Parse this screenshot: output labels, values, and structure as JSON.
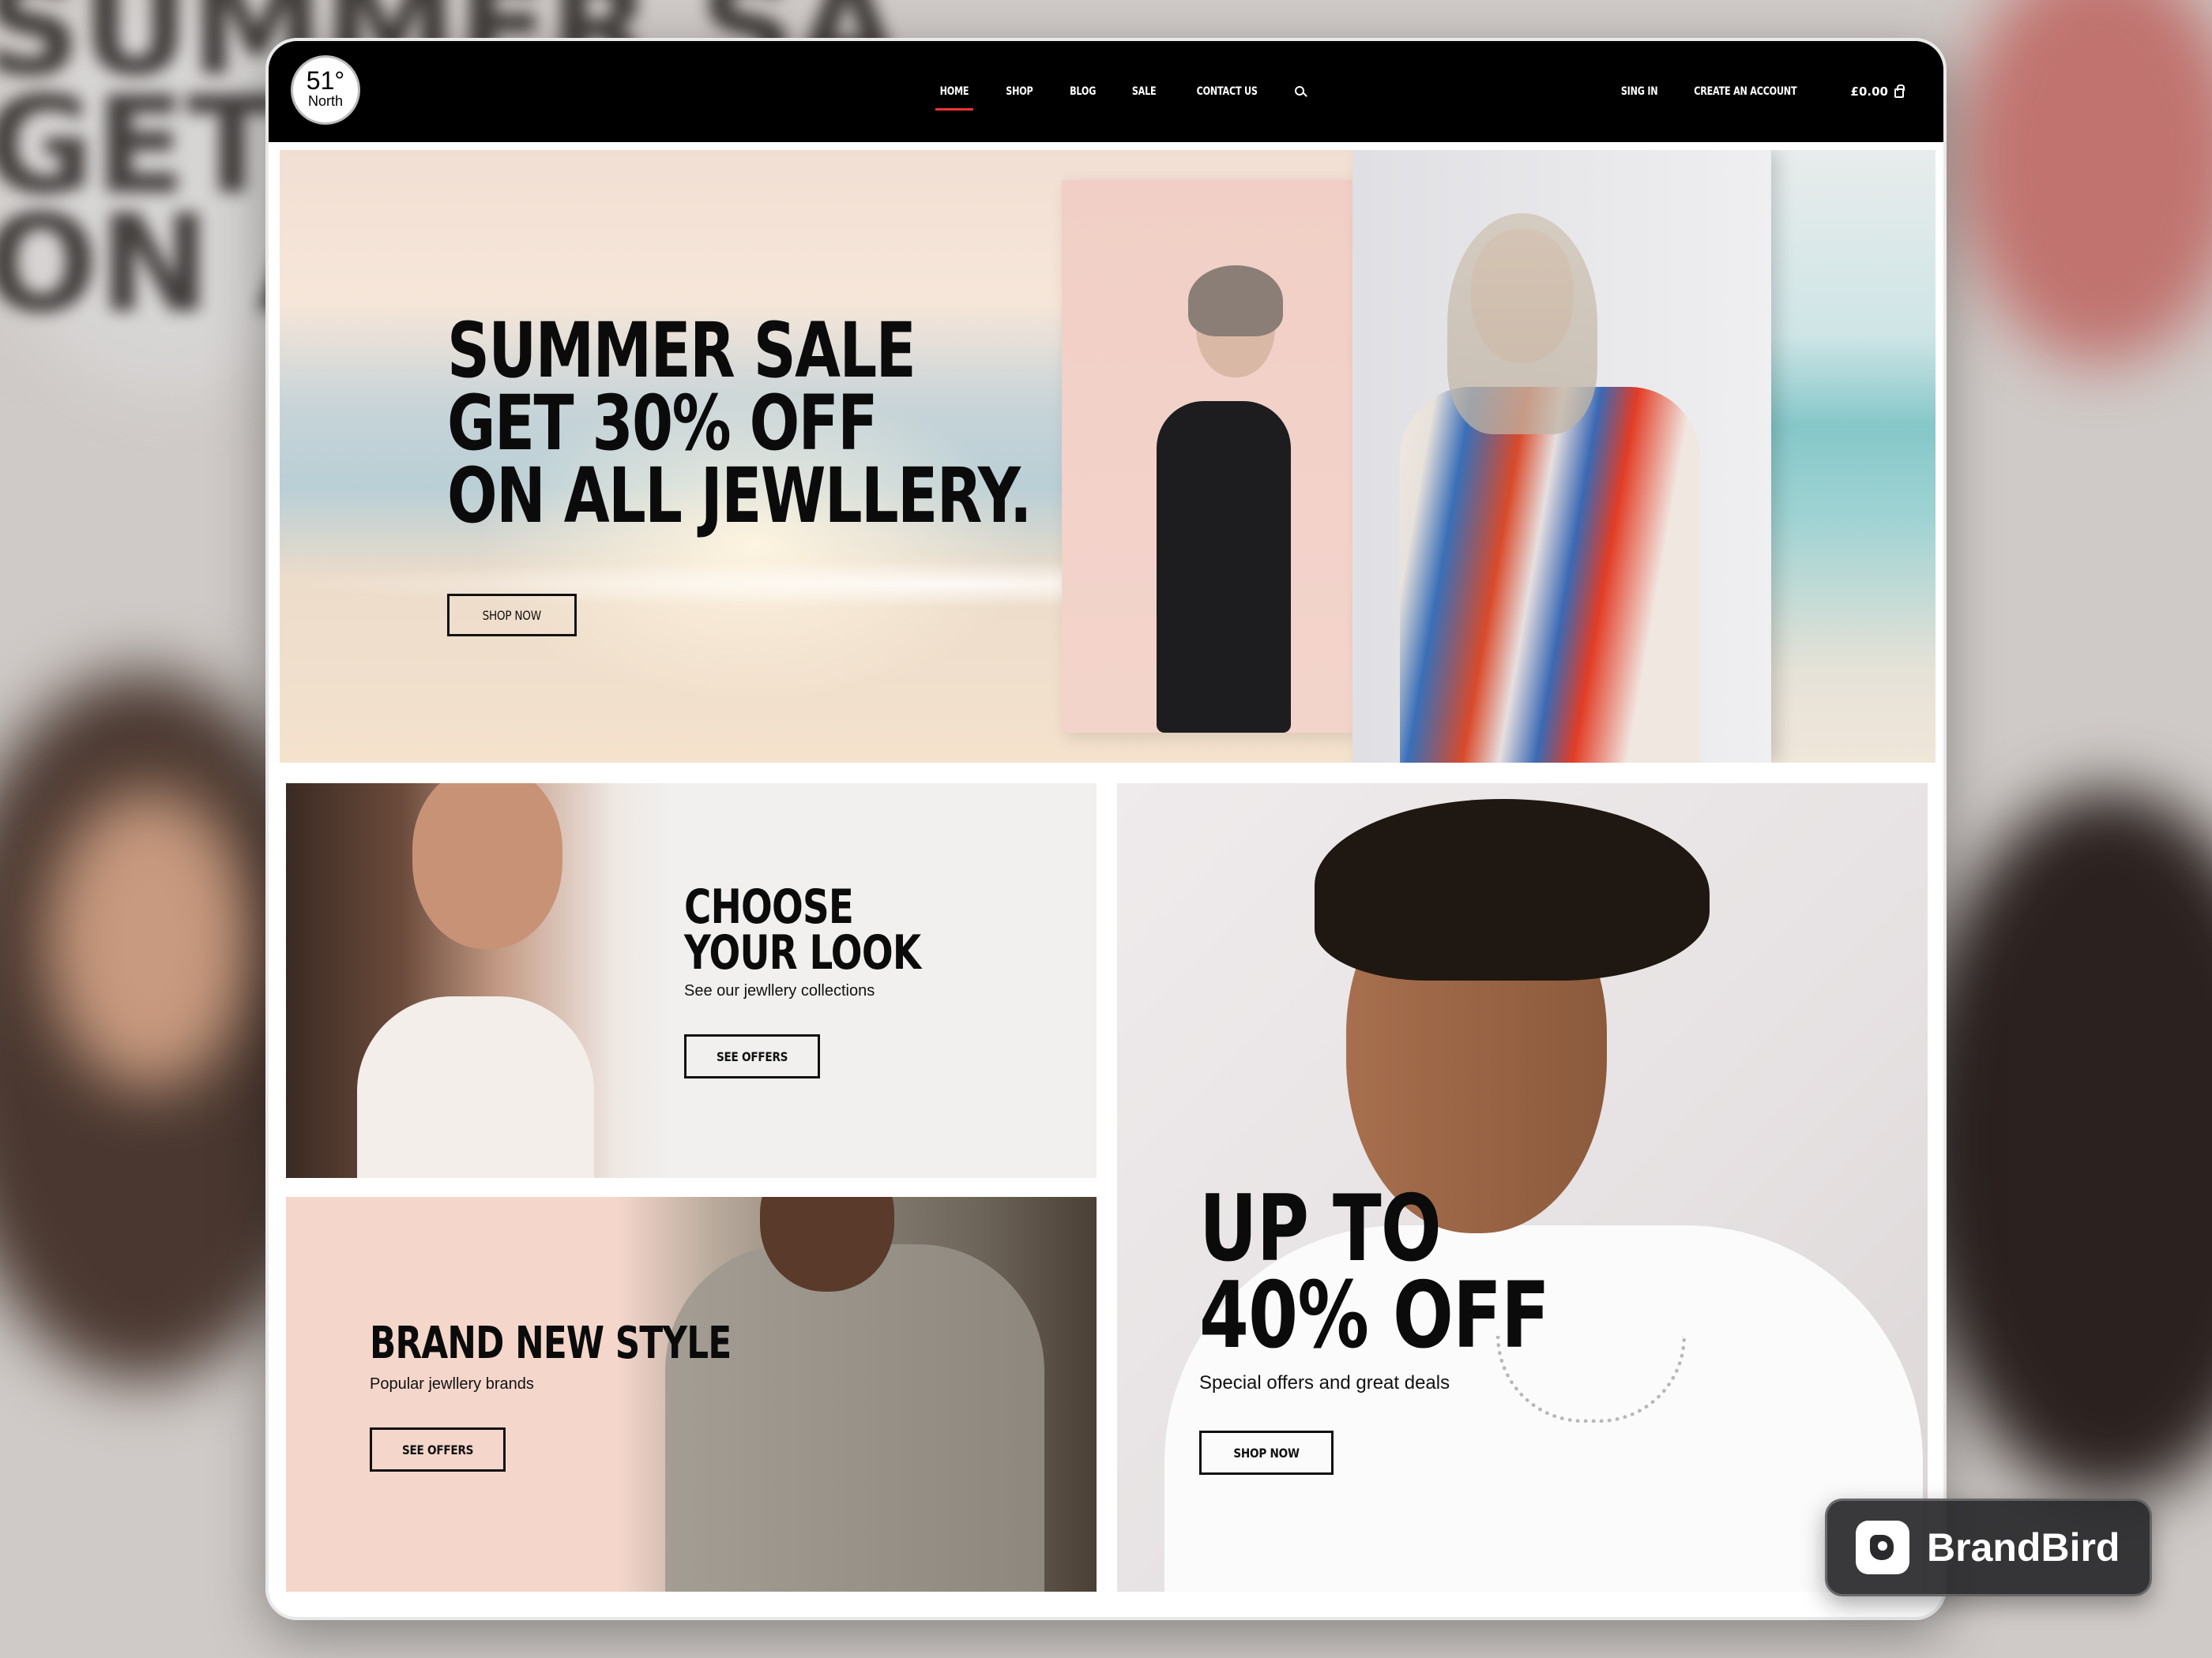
{
  "nav": {
    "logo_number": "51°",
    "logo_word": "North",
    "links": [
      "HOME",
      "SHOP",
      "BLOG",
      "SALE",
      "CONTACT US"
    ],
    "sign_in": "SING IN",
    "create_account": "CREATE AN ACCOUNT",
    "cart_total": "£0.00"
  },
  "hero": {
    "headline": "SUMMER SALE\nGET 30% OFF\nON ALL JEWLLERY.",
    "button": "SHOP NOW"
  },
  "tiles": {
    "choose": {
      "title": "CHOOSE\nYOUR LOOK",
      "subtitle": "See our jewllery collections",
      "button": "SEE OFFERS"
    },
    "brand": {
      "title": "BRAND NEW STYLE",
      "subtitle": "Popular jewllery brands",
      "button": "SEE OFFERS"
    },
    "offer": {
      "title": "UP TO\n40% OFF",
      "subtitle": "Special offers and great deals",
      "button": "SHOP NOW"
    }
  },
  "badge": {
    "label": "BrandBird"
  },
  "colors": {
    "nav_bg": "#000000",
    "active_underline": "#e33333",
    "accent_pink": "#f4d6cb"
  },
  "icons": [
    "search-icon",
    "bag-icon",
    "brandbird-logo-icon"
  ]
}
